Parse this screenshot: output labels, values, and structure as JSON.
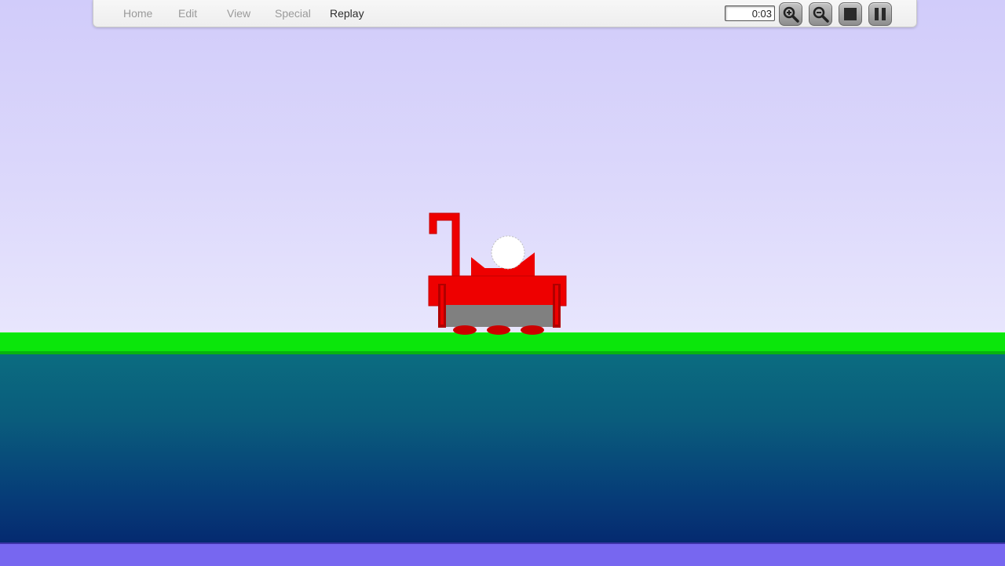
{
  "toolbar": {
    "menu": [
      {
        "label": "Home",
        "active": false
      },
      {
        "label": "Edit",
        "active": false
      },
      {
        "label": "View",
        "active": false
      },
      {
        "label": "Special",
        "active": false
      },
      {
        "label": "Replay",
        "active": true
      }
    ],
    "timer": "0:03",
    "buttons": [
      "zoom-in-icon",
      "zoom-out-icon",
      "stop-icon",
      "pause-icon"
    ]
  },
  "colors": {
    "sky": "#d1ccfa",
    "grass": "#0be60b",
    "water_top": "#0b6c80",
    "water_bottom": "#052a70",
    "vehicle": "#ee0000",
    "vehicle_dark": "#b00000",
    "vehicle_base": "#808080",
    "ball": "#ffffff",
    "bottom_strip": "#7767f0"
  }
}
